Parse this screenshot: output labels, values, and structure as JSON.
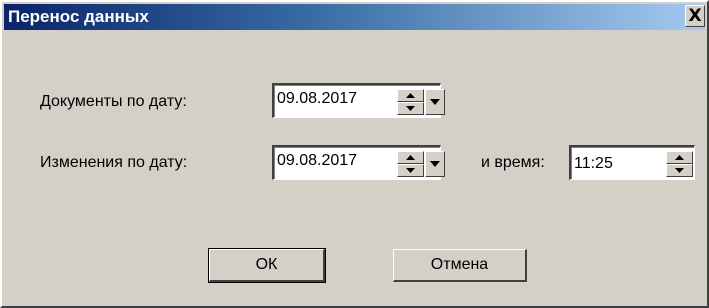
{
  "window": {
    "title": "Перенос данных",
    "close_label": "X"
  },
  "form": {
    "documents_label": "Документы по дату:",
    "documents_date": "09.08.2017",
    "changes_label": "Изменения по дату:",
    "changes_date": "09.08.2017",
    "time_label": "и время:",
    "time_value": "11:25"
  },
  "buttons": {
    "ok_label": "ОК",
    "cancel_label": "Отмена"
  },
  "icons": {
    "spin_up": "spin-up-icon",
    "spin_down": "spin-down-icon",
    "dropdown": "chevron-down-icon"
  }
}
